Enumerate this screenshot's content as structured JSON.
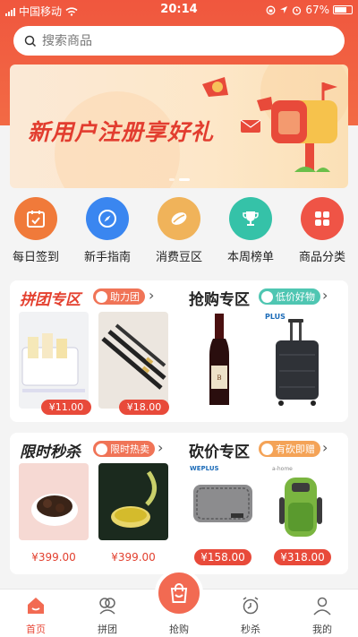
{
  "status": {
    "carrier": "中国移动",
    "time": "20:14",
    "battery": "67%"
  },
  "search": {
    "placeholder": "搜索商品"
  },
  "banner": {
    "text": "新用户注册享好礼"
  },
  "quick_icons": [
    {
      "label": "每日签到",
      "icon": "calendar-check-icon",
      "color": "#f07a3a"
    },
    {
      "label": "新手指南",
      "icon": "compass-icon",
      "color": "#3a86f0"
    },
    {
      "label": "消费豆区",
      "icon": "bean-icon",
      "color": "#f0a640"
    },
    {
      "label": "本周榜单",
      "icon": "trophy-icon",
      "color": "#35c2a8"
    },
    {
      "label": "商品分类",
      "icon": "category-grid-icon",
      "color": "#ef5446"
    }
  ],
  "sections": {
    "group": {
      "title": "拼团专区",
      "tag": "助力团",
      "prices": [
        "¥11.00",
        "¥18.00"
      ]
    },
    "flash": {
      "title": "抢购专区",
      "tag": "低价好物",
      "brand": "PLUS"
    },
    "seckill": {
      "title": "限时秒杀",
      "tag": "限时热卖",
      "prices": [
        "¥399.00",
        "¥399.00"
      ]
    },
    "bargain": {
      "title": "砍价专区",
      "tag": "有砍即赠",
      "brands": [
        "WEPLUS",
        "a-home"
      ],
      "prices": [
        "¥158.00",
        "¥318.00"
      ]
    }
  },
  "tabbar": [
    {
      "label": "首页",
      "icon": "home-icon",
      "active": true
    },
    {
      "label": "拼团",
      "icon": "group-icon",
      "active": false
    },
    {
      "label": "抢购",
      "icon": "shopping-bag-icon",
      "active": false
    },
    {
      "label": "秒杀",
      "icon": "alarm-clock-icon",
      "active": false
    },
    {
      "label": "我的",
      "icon": "user-icon",
      "active": false
    }
  ],
  "colors": {
    "brand": "#f0573e",
    "price": "#e84a3a"
  }
}
